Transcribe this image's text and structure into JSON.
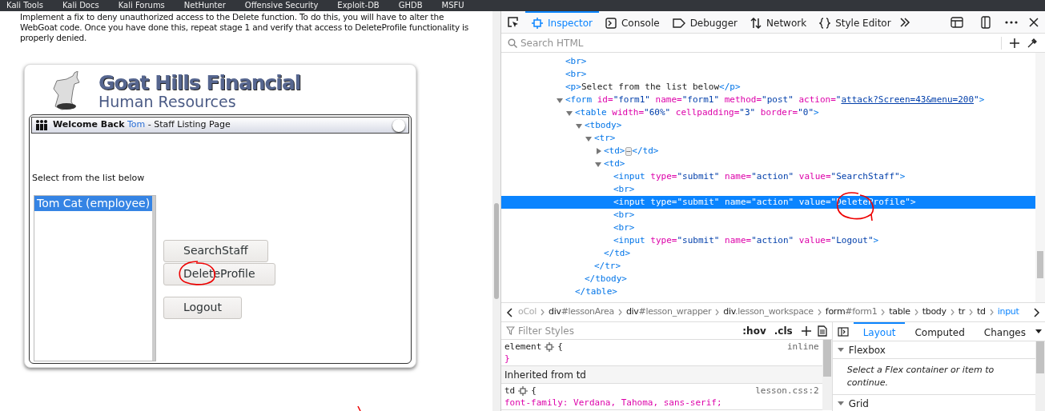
{
  "bookmarks": [
    "Kali Tools",
    "Kali Docs",
    "Kali Forums",
    "NetHunter",
    "Offensive Security",
    "Exploit-DB",
    "GHDB",
    "MSFU"
  ],
  "page": {
    "instructions": "Implement a fix to deny unauthorized access to the Delete function. To do this, you will have to alter the WebGoat code. Once you have done this, repeat stage 1 and verify that access to DeleteProfile functionality is properly denied.",
    "logo_title": "Goat Hills Financial",
    "logo_subtitle": "Human Resources",
    "header": {
      "welcome": "Welcome Back",
      "user": "Tom",
      "rest": "- Staff Listing Page"
    },
    "prompt": "Select from the list below",
    "staff_list": [
      {
        "label": "Tom Cat (employee)",
        "selected": true
      }
    ],
    "buttons": [
      "SearchStaff",
      "DeleteProfile",
      "Logout"
    ]
  },
  "devtools": {
    "tabs": [
      {
        "label": "Inspector",
        "selected": true
      },
      {
        "label": "Console",
        "selected": false
      },
      {
        "label": "Debugger",
        "selected": false
      },
      {
        "label": "Network",
        "selected": false
      },
      {
        "label": "Style Editor",
        "selected": false
      }
    ],
    "search_placeholder": "Search HTML",
    "tree": [
      {
        "selected": false,
        "tokens": [
          {
            "kind": "tag",
            "text": "<br>"
          }
        ]
      },
      {
        "selected": false,
        "tokens": [
          {
            "kind": "tag",
            "text": "<br>"
          }
        ]
      },
      {
        "selected": false,
        "tokens": [
          {
            "kind": "tag",
            "text": "<p>"
          },
          {
            "kind": "text",
            "text": "Select from the list below"
          },
          {
            "kind": "tag",
            "text": "</p>"
          }
        ]
      },
      {
        "selected": false,
        "expanded": true,
        "tokens": [
          {
            "kind": "tag",
            "text": "<form"
          },
          {
            "kind": "attr",
            "text": " id="
          },
          {
            "kind": "val",
            "text": "\"form1\""
          },
          {
            "kind": "attr",
            "text": " name="
          },
          {
            "kind": "val",
            "text": "\"form1\""
          },
          {
            "kind": "attr",
            "text": " method="
          },
          {
            "kind": "val",
            "text": "\"post\""
          },
          {
            "kind": "attr",
            "text": " action="
          },
          {
            "kind": "val",
            "text": "\""
          },
          {
            "kind": "link",
            "text": "attack?Screen=43&menu=200"
          },
          {
            "kind": "val",
            "text": "\""
          },
          {
            "kind": "tag",
            "text": ">"
          }
        ],
        "children": [
          {
            "selected": false,
            "expanded": true,
            "tokens": [
              {
                "kind": "tag",
                "text": "<table"
              },
              {
                "kind": "attr",
                "text": " width="
              },
              {
                "kind": "val",
                "text": "\"60%\""
              },
              {
                "kind": "attr",
                "text": " cellpadding="
              },
              {
                "kind": "val",
                "text": "\"3\""
              },
              {
                "kind": "attr",
                "text": " border="
              },
              {
                "kind": "val",
                "text": "\"0\""
              },
              {
                "kind": "tag",
                "text": ">"
              }
            ],
            "children": [
              {
                "selected": false,
                "expanded": true,
                "tokens": [
                  {
                    "kind": "tag",
                    "text": "<tbody>"
                  }
                ],
                "children": [
                  {
                    "selected": false,
                    "expanded": true,
                    "tokens": [
                      {
                        "kind": "tag",
                        "text": "<tr>"
                      }
                    ],
                    "children": [
                      {
                        "selected": false,
                        "expanded": false,
                        "tokens": [
                          {
                            "kind": "tag",
                            "text": "<td>"
                          },
                          {
                            "kind": "more",
                            "text": "⋯"
                          },
                          {
                            "kind": "tag",
                            "text": "</td>"
                          }
                        ]
                      },
                      {
                        "selected": false,
                        "expanded": true,
                        "tokens": [
                          {
                            "kind": "tag",
                            "text": "<td>"
                          }
                        ],
                        "children": [
                          {
                            "selected": false,
                            "tokens": [
                              {
                                "kind": "tag",
                                "text": "<input"
                              },
                              {
                                "kind": "attr",
                                "text": " type="
                              },
                              {
                                "kind": "val",
                                "text": "\"submit\""
                              },
                              {
                                "kind": "attr",
                                "text": " name="
                              },
                              {
                                "kind": "val",
                                "text": "\"action\""
                              },
                              {
                                "kind": "attr",
                                "text": " value="
                              },
                              {
                                "kind": "val",
                                "text": "\"SearchStaff\""
                              },
                              {
                                "kind": "tag",
                                "text": ">"
                              }
                            ]
                          },
                          {
                            "selected": false,
                            "tokens": [
                              {
                                "kind": "tag",
                                "text": "<br>"
                              }
                            ]
                          },
                          {
                            "selected": true,
                            "tokens": [
                              {
                                "kind": "tag",
                                "text": "<input"
                              },
                              {
                                "kind": "attr",
                                "text": " type="
                              },
                              {
                                "kind": "val",
                                "text": "\"submit\""
                              },
                              {
                                "kind": "attr",
                                "text": " name="
                              },
                              {
                                "kind": "val",
                                "text": "\"action\""
                              },
                              {
                                "kind": "attr",
                                "text": " value="
                              },
                              {
                                "kind": "val",
                                "text": "\"DeleteProfile\""
                              },
                              {
                                "kind": "tag",
                                "text": ">"
                              }
                            ]
                          },
                          {
                            "selected": false,
                            "tokens": [
                              {
                                "kind": "tag",
                                "text": "<br>"
                              }
                            ]
                          },
                          {
                            "selected": false,
                            "tokens": [
                              {
                                "kind": "tag",
                                "text": "<br>"
                              }
                            ]
                          },
                          {
                            "selected": false,
                            "tokens": [
                              {
                                "kind": "tag",
                                "text": "<input"
                              },
                              {
                                "kind": "attr",
                                "text": " type="
                              },
                              {
                                "kind": "val",
                                "text": "\"submit\""
                              },
                              {
                                "kind": "attr",
                                "text": " name="
                              },
                              {
                                "kind": "val",
                                "text": "\"action\""
                              },
                              {
                                "kind": "attr",
                                "text": " value="
                              },
                              {
                                "kind": "val",
                                "text": "\"Logout\""
                              },
                              {
                                "kind": "tag",
                                "text": ">"
                              }
                            ]
                          }
                        ]
                      },
                      {
                        "selected": false,
                        "tokens": [
                          {
                            "kind": "tag",
                            "text": "</td>"
                          }
                        ]
                      }
                    ]
                  },
                  {
                    "selected": false,
                    "tokens": [
                      {
                        "kind": "tag",
                        "text": "</tr>"
                      }
                    ]
                  }
                ]
              },
              {
                "selected": false,
                "tokens": [
                  {
                    "kind": "tag",
                    "text": "</tbody>"
                  }
                ]
              }
            ]
          },
          {
            "selected": false,
            "tokens": [
              {
                "kind": "tag",
                "text": "</table>"
              }
            ]
          }
        ]
      }
    ],
    "breadcrumbs": [
      {
        "id": "oCol",
        "selected": false
      },
      {
        "tag": "div",
        "id": "#lessonArea",
        "selected": false
      },
      {
        "tag": "div",
        "id": "#lesson_wrapper",
        "selected": false
      },
      {
        "tag": "div",
        "id": ".lesson_workspace",
        "selected": false
      },
      {
        "tag": "form",
        "id": "#form1",
        "selected": false
      },
      {
        "tag": "table",
        "selected": false
      },
      {
        "tag": "tbody",
        "selected": false
      },
      {
        "tag": "tr",
        "selected": false
      },
      {
        "tag": "td",
        "selected": false
      },
      {
        "tag": "input",
        "selected": true
      }
    ],
    "filter_placeholder": "Filter Styles",
    "rule_tools": [
      ":hov",
      ".cls"
    ],
    "rules": [
      {
        "kind": "rule",
        "selector": "element",
        "brace": "{",
        "source": "inline",
        "body": "}"
      },
      {
        "kind": "heading",
        "text": "Inherited from td"
      },
      {
        "kind": "rule",
        "selector": "td",
        "brace": "{",
        "source": "lesson.css:2",
        "body": "font-family: Verdana, Tahoma, sans-serif;"
      }
    ],
    "side_tabs": [
      {
        "label": "Layout",
        "selected": true
      },
      {
        "label": "Computed",
        "selected": false
      },
      {
        "label": "Changes",
        "selected": false
      }
    ],
    "sections": [
      {
        "title": "Flexbox",
        "note": "Select a Flex container or item to continue."
      },
      {
        "title": "Grid"
      }
    ]
  }
}
